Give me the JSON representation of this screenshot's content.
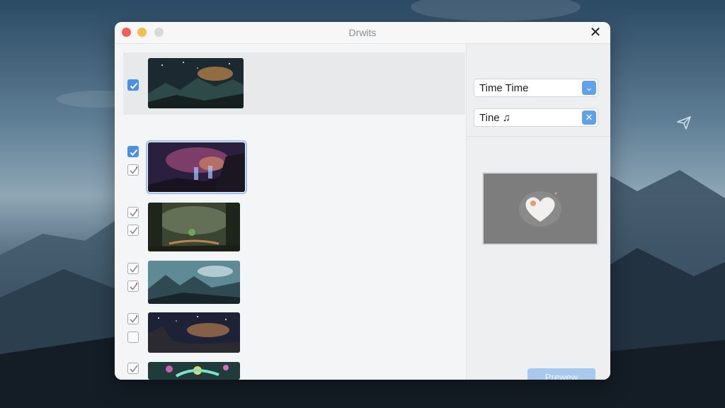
{
  "window": {
    "title": "Drwits",
    "close_glyph": "✕"
  },
  "controls": {
    "combo1": {
      "label": "Time Time",
      "button_icon": "chevron-down-icon",
      "button_glyph": "⌄"
    },
    "combo2": {
      "label": "Tine ♫",
      "button_icon": "close-icon",
      "button_glyph": "✕"
    }
  },
  "preview": {
    "button_label": "Prewew",
    "image_icon": "heart-icon"
  },
  "list": [
    {
      "checkboxes": [
        "blue"
      ]
    },
    {
      "checkboxes": [
        "blue",
        "check"
      ]
    },
    {
      "checkboxes": [
        "check",
        "check"
      ]
    },
    {
      "checkboxes": [
        "check",
        "check"
      ]
    },
    {
      "checkboxes": [
        "check",
        "empty"
      ]
    },
    {
      "checkboxes": [
        "check",
        "empty"
      ]
    }
  ],
  "colors": {
    "accent": "#4a90e2",
    "preview_button": "#a8c8ec",
    "check_red": "#d9534f"
  },
  "desktop": {
    "floating_icon": "send-icon"
  }
}
